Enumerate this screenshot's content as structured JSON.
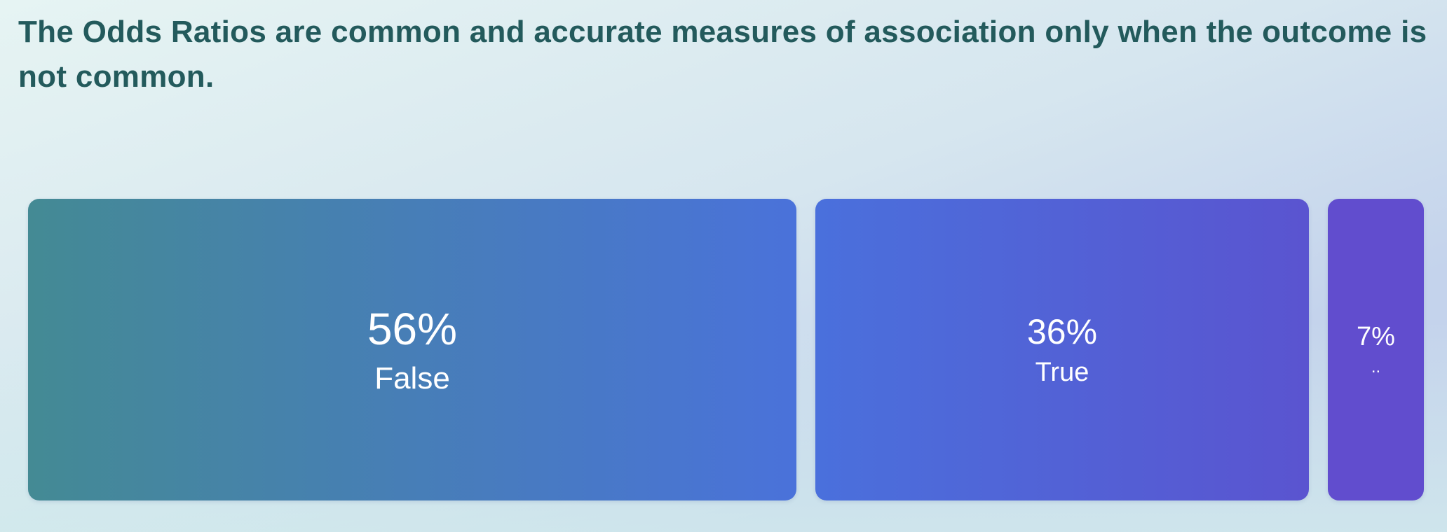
{
  "title": "The Odds Ratios are common and accurate measures of association only when the outcome is not common.",
  "chart_data": {
    "type": "treemap",
    "title": "The Odds Ratios are common and accurate measures of association only when the outcome is not common.",
    "categories": [
      "False",
      "True",
      ".."
    ],
    "values": [
      56,
      36,
      7
    ],
    "labels": [
      "56%",
      "36%",
      "7%"
    ],
    "colors": {
      "start": "#448a94",
      "mid": "#4a70dc",
      "end": "#614cce"
    }
  }
}
